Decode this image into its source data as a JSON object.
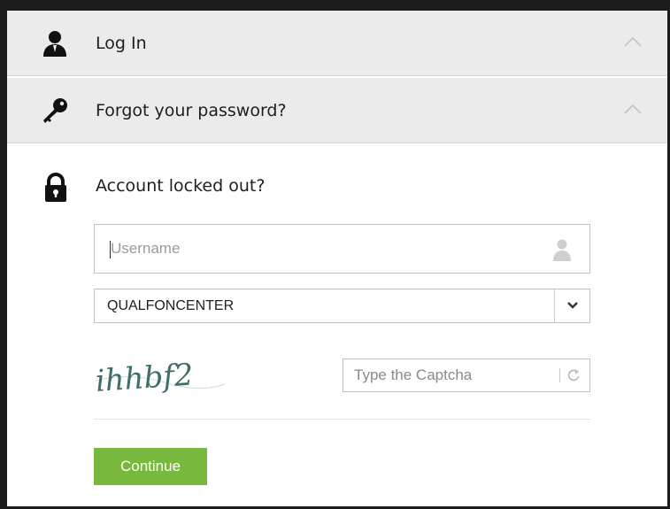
{
  "accordion": {
    "login": {
      "title": "Log In",
      "icon": "user-icon"
    },
    "forgot": {
      "title": "Forgot your password?",
      "icon": "key-icon"
    },
    "locked": {
      "title": "Account locked out?",
      "icon": "lock-icon"
    }
  },
  "form": {
    "username": {
      "placeholder": "Username",
      "value": "",
      "icon": "user-icon"
    },
    "domain": {
      "selected": "QUALFONCENTER",
      "icon": "chevron-down-icon"
    },
    "captcha": {
      "image_text": "ihhbf2",
      "placeholder": "Type the Captcha",
      "value": "",
      "refresh_icon": "refresh-icon"
    },
    "continue_label": "Continue"
  },
  "colors": {
    "header_bg": "#ebebeb",
    "button_green": "#78b83c",
    "border": "#bfbfbf",
    "text": "#1e1e1e"
  }
}
